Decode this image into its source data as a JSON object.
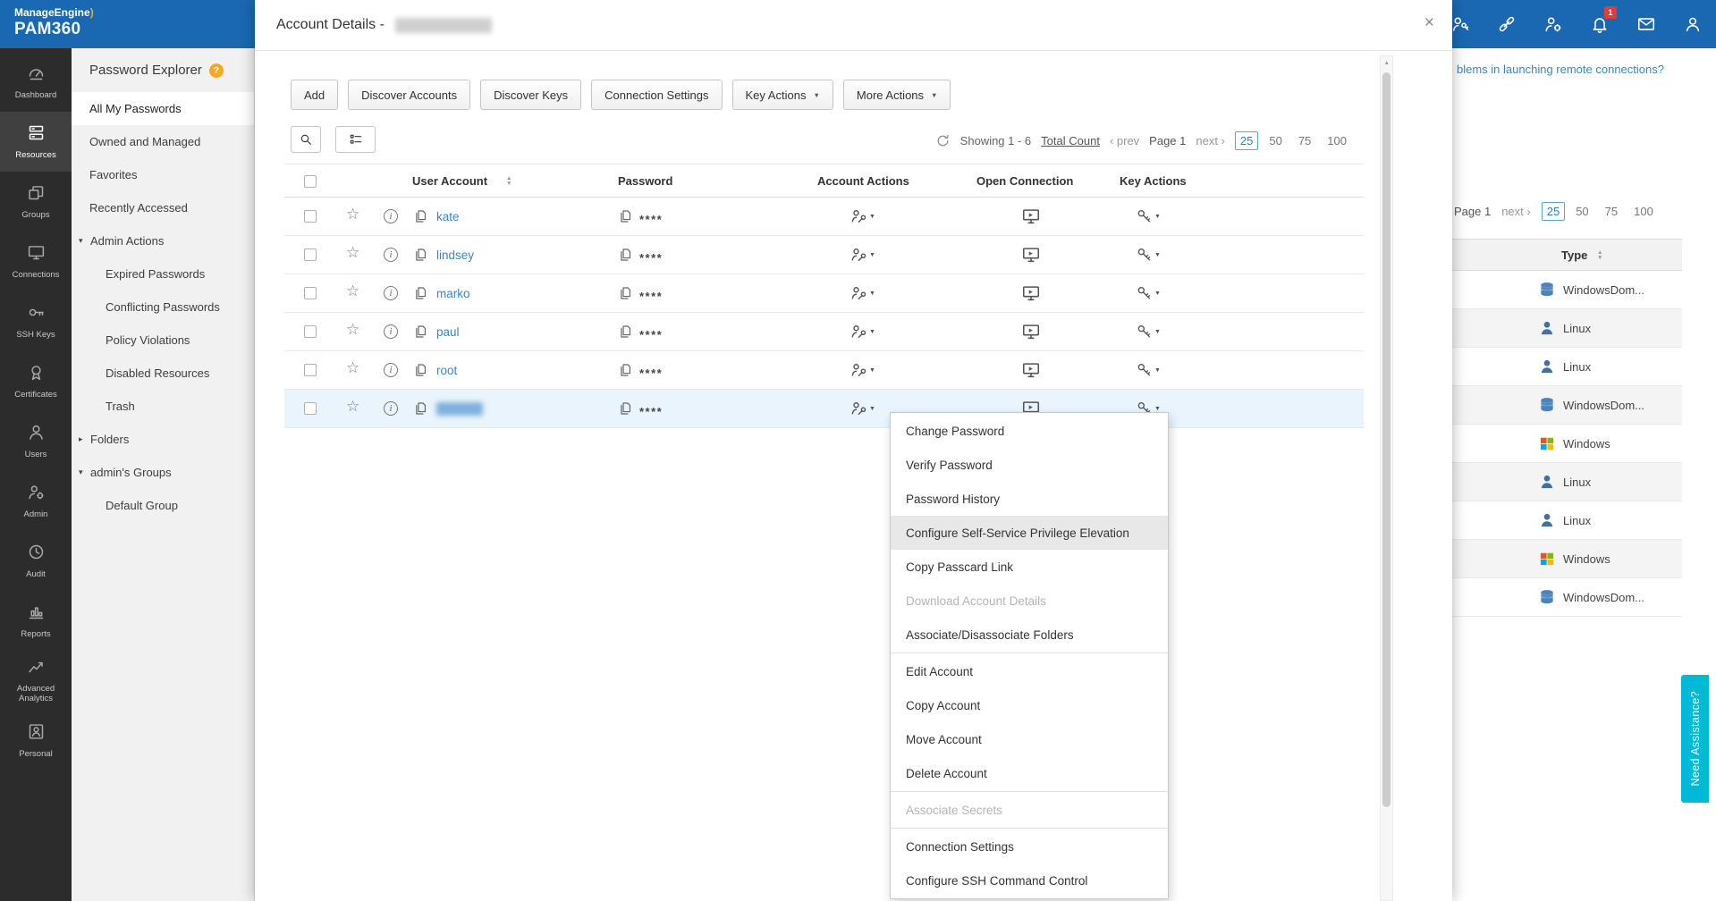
{
  "brand": {
    "company": "ManageEngine",
    "accent": ")",
    "product": "PAM360"
  },
  "icons": {
    "sort_up": "▲",
    "sort_down": "▼",
    "caret": "▼",
    "expanded": "▾",
    "collapsed": "▸",
    "star": "☆",
    "info": "i",
    "close": "×"
  },
  "header": {
    "icons": [
      {
        "name": "key-user"
      },
      {
        "name": "link"
      },
      {
        "name": "user-gear"
      },
      {
        "name": "bell",
        "badge": "1"
      },
      {
        "name": "mail"
      },
      {
        "name": "user"
      }
    ]
  },
  "left_nav": {
    "items": [
      {
        "label": "Dashboard",
        "icon": "dashboard"
      },
      {
        "label": "Resources",
        "icon": "resources",
        "active": true
      },
      {
        "label": "Groups",
        "icon": "groups"
      },
      {
        "label": "Connections",
        "icon": "connections"
      },
      {
        "label": "SSH Keys",
        "icon": "ssh-keys"
      },
      {
        "label": "Certificates",
        "icon": "certificates"
      },
      {
        "label": "Users",
        "icon": "users"
      },
      {
        "label": "Admin",
        "icon": "admin"
      },
      {
        "label": "Audit",
        "icon": "audit"
      },
      {
        "label": "Reports",
        "icon": "reports"
      },
      {
        "label": "Advanced Analytics",
        "icon": "analytics"
      },
      {
        "label": "Personal",
        "icon": "personal"
      }
    ]
  },
  "explorer": {
    "title": "Password Explorer",
    "help": "?",
    "items": [
      {
        "label": "All My Passwords",
        "level": 0,
        "active": true
      },
      {
        "label": "Owned and Managed",
        "level": 0
      },
      {
        "label": "Favorites",
        "level": 0
      },
      {
        "label": "Recently Accessed",
        "level": 0
      },
      {
        "label": "Admin Actions",
        "level": 0,
        "expanded": true
      },
      {
        "label": "Expired Passwords",
        "level": 1
      },
      {
        "label": "Conflicting Passwords",
        "level": 1
      },
      {
        "label": "Policy Violations",
        "level": 1
      },
      {
        "label": "Disabled Resources",
        "level": 1
      },
      {
        "label": "Trash",
        "level": 1
      },
      {
        "label": "Folders",
        "level": 0,
        "collapsed": true
      },
      {
        "label": "admin's Groups",
        "level": 0,
        "expanded": true
      },
      {
        "label": "Default Group",
        "level": 1
      }
    ]
  },
  "modal": {
    "title": "Account Details -",
    "toolbar": [
      {
        "label": "Add"
      },
      {
        "label": "Discover Accounts"
      },
      {
        "label": "Discover Keys"
      },
      {
        "label": "Connection Settings"
      },
      {
        "label": "Key Actions",
        "caret": true
      },
      {
        "label": "More Actions",
        "caret": true
      }
    ],
    "pagination": {
      "showing": "Showing 1 - 6",
      "total": "Total Count",
      "prev": "‹ prev",
      "page": "Page 1",
      "next": "next ›",
      "sizes": [
        "25",
        "50",
        "75",
        "100"
      ],
      "selected": "25"
    },
    "table": {
      "headers": {
        "user": "User Account",
        "password": "Password",
        "actions": "Account Actions",
        "open": "Open Connection",
        "key": "Key Actions"
      },
      "password_mask": "****",
      "rows": [
        {
          "user": "kate"
        },
        {
          "user": "lindsey"
        },
        {
          "user": "marko"
        },
        {
          "user": "paul"
        },
        {
          "user": "root"
        },
        {
          "user": "",
          "redacted": true,
          "selected": true
        }
      ]
    }
  },
  "context_menu": {
    "items": [
      {
        "label": "Change Password"
      },
      {
        "label": "Verify Password"
      },
      {
        "label": "Password History"
      },
      {
        "label": "Configure Self-Service Privilege Elevation",
        "highlighted": true
      },
      {
        "label": "Copy Passcard Link"
      },
      {
        "label": "Download Account Details",
        "disabled": true
      },
      {
        "label": "Associate/Disassociate Folders",
        "separator_after": true
      },
      {
        "label": "Edit Account"
      },
      {
        "label": "Copy Account"
      },
      {
        "label": "Move Account"
      },
      {
        "label": "Delete Account",
        "separator_after": true
      },
      {
        "label": "Associate Secrets",
        "disabled": true,
        "separator_after": true
      },
      {
        "label": "Connection Settings"
      },
      {
        "label": "Configure SSH Command Control"
      }
    ]
  },
  "background": {
    "help_link": "blems in launching remote connections?",
    "pagination": {
      "page": "Page 1",
      "next": "next ›",
      "sizes": [
        "25",
        "50",
        "75",
        "100"
      ],
      "selected": "25"
    },
    "type_header": "Type",
    "rows": [
      {
        "type": "WindowsDom...",
        "icon": "database"
      },
      {
        "type": "Linux",
        "icon": "linux"
      },
      {
        "type": "Linux",
        "icon": "linux"
      },
      {
        "type": "WindowsDom...",
        "icon": "database"
      },
      {
        "type": "Windows",
        "icon": "windows"
      },
      {
        "type": "Linux",
        "icon": "linux"
      },
      {
        "type": "Linux",
        "icon": "linux"
      },
      {
        "type": "Windows",
        "icon": "windows"
      },
      {
        "type": "WindowsDom...",
        "icon": "database"
      }
    ]
  },
  "assist_tab": "Need Assistance?",
  "colors": {
    "header_blue": "#1b68b2",
    "sidebar_dark": "#2c2c2c",
    "accent_link": "#3a87c8",
    "assist_cyan": "#00b9d6",
    "selected_row": "#e9f4fc",
    "brand_orange": "#f6a821"
  }
}
